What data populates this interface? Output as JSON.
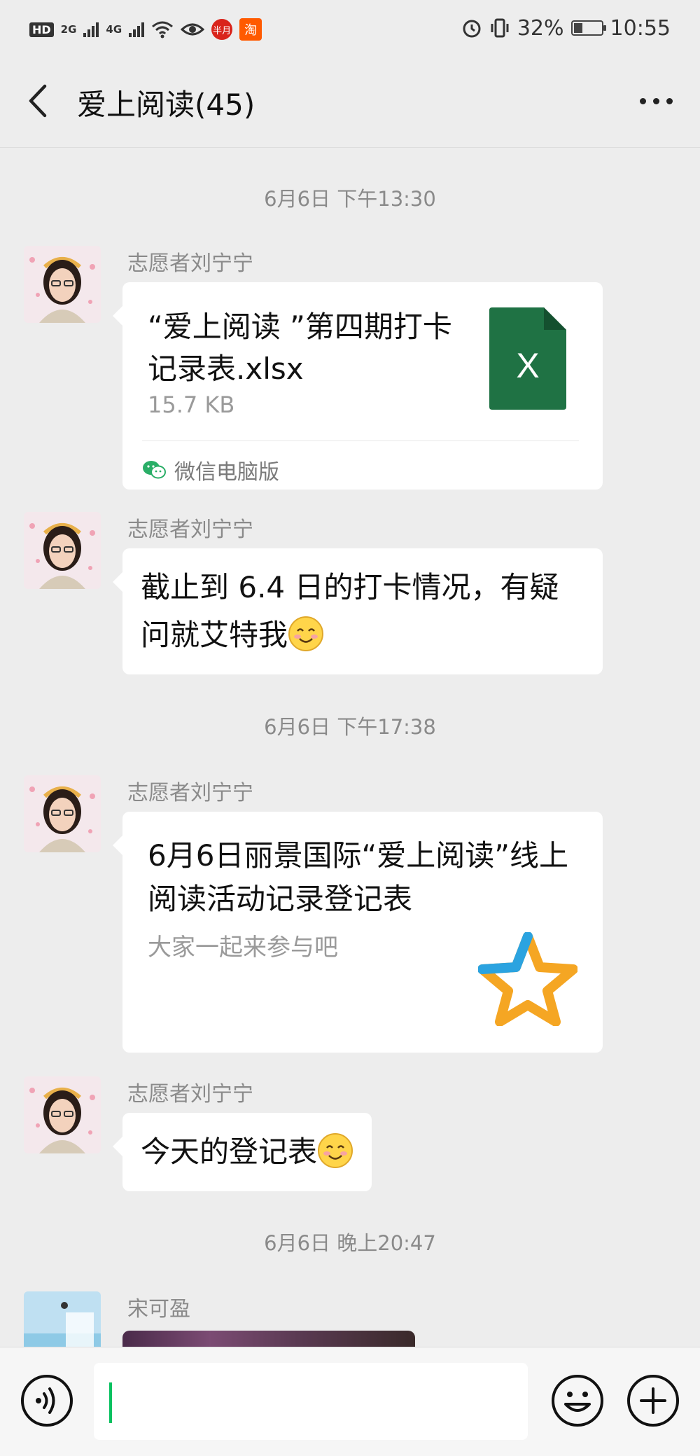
{
  "status_bar": {
    "hd": "HD",
    "sim1_network": "2G",
    "sim2_network": "4G",
    "app1_label": "半月",
    "app2_label": "淘",
    "battery_percent": 32,
    "battery_text": "32%",
    "time": "10:55"
  },
  "header": {
    "title": "爱上阅读(45)"
  },
  "chat": {
    "timestamps": [
      "6月6日 下午13:30",
      "6月6日 下午17:38",
      "6月6日 晚上20:47"
    ],
    "messages": [
      {
        "sender": "志愿者刘宁宁",
        "type": "file",
        "file_name": "“爱上阅读 ”第四期打卡记录表.xlsx",
        "file_size": "15.7 KB",
        "file_icon_label": "X",
        "source": "微信电脑版"
      },
      {
        "sender": "志愿者刘宁宁",
        "type": "text",
        "text": "截止到 6.4 日的打卡情况，有疑问就艾特我",
        "emoji": "smile"
      },
      {
        "sender": "志愿者刘宁宁",
        "type": "link",
        "title": "6月6日丽景国际“爱上阅读”线上阅读活动记录登记表",
        "description": "大家一起来参与吧"
      },
      {
        "sender": "志愿者刘宁宁",
        "type": "text",
        "text": "今天的登记表",
        "emoji": "smile"
      },
      {
        "sender": "宋可盈",
        "type": "image"
      }
    ]
  },
  "input_bar": {
    "voice_icon": "voice-icon",
    "emoji_icon": "emoji-icon",
    "plus_icon": "plus-icon",
    "caret_color": "#07c160"
  },
  "colors": {
    "background": "#ededed",
    "bubble": "#ffffff",
    "excel_green": "#1f7244",
    "accent_green": "#07c160"
  }
}
